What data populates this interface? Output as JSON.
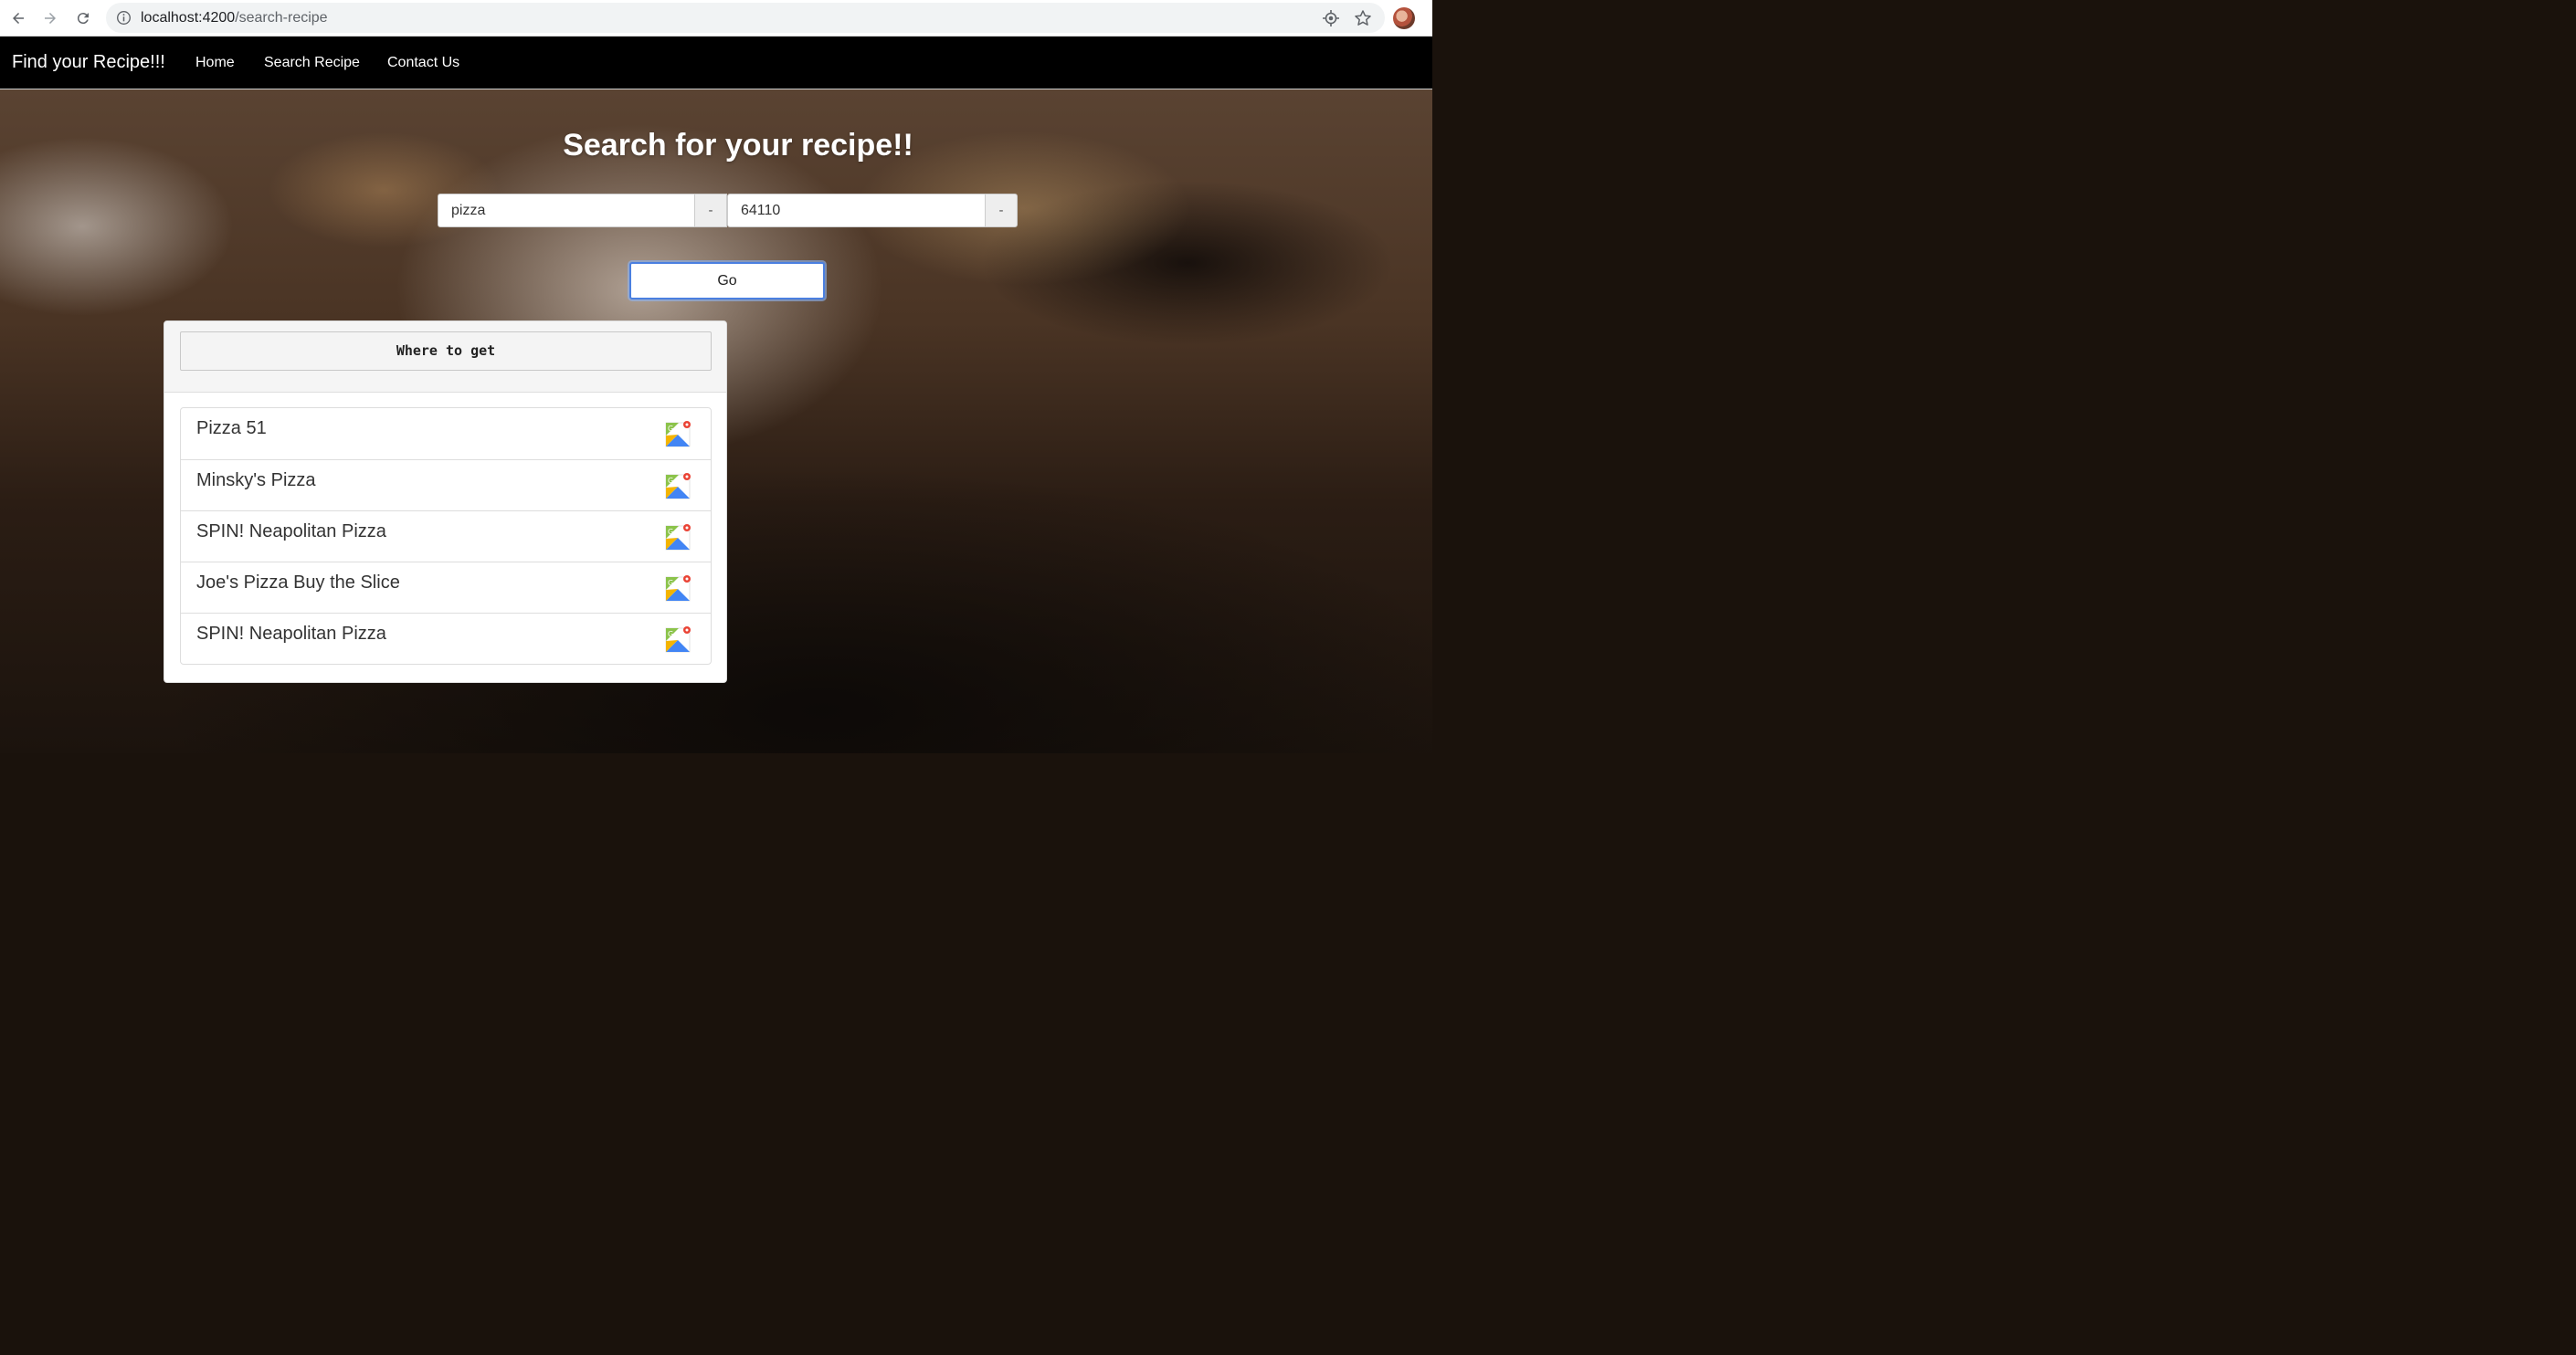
{
  "browser": {
    "url_host": "localhost:4200",
    "url_path": "/search-recipe",
    "icons": [
      "back-arrow-icon",
      "forward-arrow-icon",
      "reload-icon",
      "info-icon",
      "location-icon",
      "star-icon",
      "profile-avatar"
    ]
  },
  "navbar": {
    "brand": "Find your Recipe!!!",
    "links": [
      "Home",
      "Search Recipe",
      "Contact Us"
    ]
  },
  "search": {
    "headline": "Search for your recipe!!",
    "recipe_value": "pizza",
    "zip_value": "64110",
    "recipe_addon": "-",
    "zip_addon": "-",
    "go_label": "Go"
  },
  "results": {
    "header_button": "Where to get",
    "items": [
      {
        "name": "Pizza 51",
        "icon": "google-maps-icon"
      },
      {
        "name": "Minsky's Pizza",
        "icon": "google-maps-icon"
      },
      {
        "name": "SPIN! Neapolitan Pizza",
        "icon": "google-maps-icon"
      },
      {
        "name": "Joe's Pizza Buy the Slice",
        "icon": "google-maps-icon"
      },
      {
        "name": "SPIN! Neapolitan Pizza",
        "icon": "google-maps-icon"
      }
    ]
  }
}
